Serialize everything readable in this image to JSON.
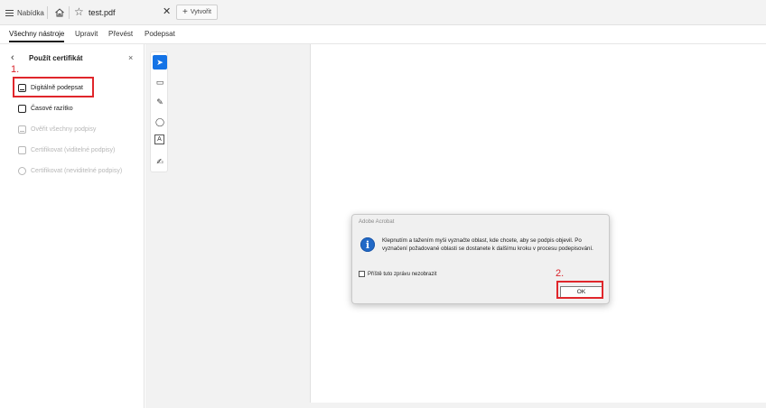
{
  "tabbar": {
    "menu_label": "Nabídka",
    "document_tab": "test.pdf",
    "close_glyph": "✕",
    "new_tab_label": "Vytvořit",
    "new_tab_plus": "+",
    "star_glyph": "☆"
  },
  "tool_tabs": [
    {
      "label": "Všechny nástroje",
      "active": true
    },
    {
      "label": "Upravit",
      "active": false
    },
    {
      "label": "Převést",
      "active": false
    },
    {
      "label": "Podepsat",
      "active": false
    }
  ],
  "panel": {
    "back_glyph": "‹",
    "title": "Použít certifikát",
    "close_glyph": "×",
    "items": [
      {
        "label": "Digitálně podepsat",
        "enabled": true,
        "icon": "signature-icon"
      },
      {
        "label": "Časové razítko",
        "enabled": true,
        "icon": "timestamp-icon"
      },
      {
        "label": "Ověřit všechny podpisy",
        "enabled": false,
        "icon": "verify-signatures-icon"
      },
      {
        "label": "Certifikovat (viditelné podpisy)",
        "enabled": false,
        "icon": "certify-visible-icon"
      },
      {
        "label": "Certifikovat (neviditelné podpisy)",
        "enabled": false,
        "icon": "certify-invisible-icon"
      }
    ]
  },
  "annotations": {
    "step1": "1.",
    "step2": "2.",
    "color": "#e0262b"
  },
  "tools": [
    {
      "name": "select-tool-icon",
      "glyph": "➤",
      "selected": true
    },
    {
      "name": "comment-tool-icon",
      "glyph": "▭",
      "selected": false
    },
    {
      "name": "draw-tool-icon",
      "glyph": "✎",
      "selected": false
    },
    {
      "name": "lasso-tool-icon",
      "glyph": "◯",
      "selected": false
    },
    {
      "name": "text-tool-icon",
      "glyph": "A",
      "selected": false
    },
    {
      "name": "sign-tool-icon",
      "glyph": "✍",
      "selected": false
    }
  ],
  "dialog": {
    "title": "Adobe Acrobat",
    "info_glyph": "i",
    "message": "Klepnutím a tažením myši vyznačte oblast, kde chcete, aby se podpis objevil. Po vyznačení požadované oblasti se dostanete k dalšímu kroku v procesu podepisování.",
    "checkbox_label": "Příště tuto zprávu nezobrazit",
    "ok_label": "OK"
  },
  "colors": {
    "accent": "#1473e6",
    "info_blue": "#2169c7"
  }
}
